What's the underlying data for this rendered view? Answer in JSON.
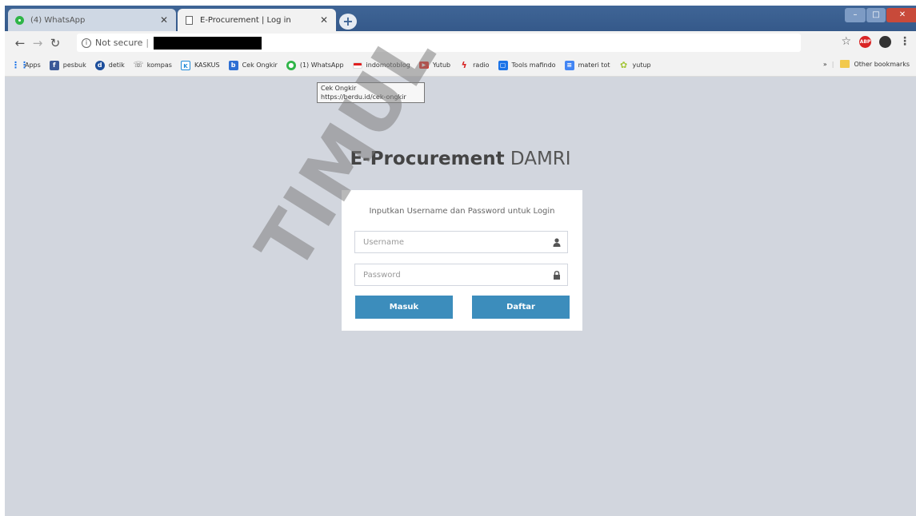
{
  "browser": {
    "tabs": [
      {
        "title": "(4) WhatsApp",
        "icon": "whatsapp-icon",
        "active": false
      },
      {
        "title": "E-Procurement | Log in",
        "icon": "page-icon",
        "active": true
      }
    ],
    "address": {
      "security_label": "Not secure"
    },
    "bookmarks": [
      {
        "label": "Apps",
        "icon": "apps-grid-icon",
        "color": "#1a73e8"
      },
      {
        "label": "pesbuk",
        "icon": "facebook-icon",
        "color": "#3b5998"
      },
      {
        "label": "detik",
        "icon": "detik-icon",
        "color": "#1d4f9c"
      },
      {
        "label": "kompas",
        "icon": "kompas-icon",
        "color": "#555555"
      },
      {
        "label": "KASKUS",
        "icon": "kaskus-icon",
        "color": "#1f8ad8"
      },
      {
        "label": "Cek Ongkir",
        "icon": "berdu-icon",
        "color": "#2e6fd3"
      },
      {
        "label": "(1) WhatsApp",
        "icon": "whatsapp-icon",
        "color": "#2fb548"
      },
      {
        "label": "indomotoblog",
        "icon": "flag-icon",
        "color": "#e02020"
      },
      {
        "label": "Yutub",
        "icon": "youtube-icon",
        "color": "#e62117"
      },
      {
        "label": "radio",
        "icon": "radio-icon",
        "color": "#d62020"
      },
      {
        "label": "Tools mafindo",
        "icon": "tools-icon",
        "color": "#1a73e8"
      },
      {
        "label": "materi tot",
        "icon": "doc-icon",
        "color": "#4285f4"
      },
      {
        "label": "yutup",
        "icon": "android-icon",
        "color": "#a4c639"
      }
    ],
    "bookmarks_overflow": "»",
    "other_bookmarks": "Other bookmarks",
    "tooltip": {
      "line1": "Cek Ongkir",
      "line2": "https://berdu.id/cek-ongkir"
    }
  },
  "login": {
    "brand_bold": "E-Procurement",
    "brand_light": "DAMRI",
    "message": "Inputkan Username dan Password untuk Login",
    "username_placeholder": "Username",
    "password_placeholder": "Password",
    "login_button": "Masuk",
    "register_button": "Daftar"
  },
  "watermark": "TIMUL",
  "colors": {
    "primary_button": "#3c8dbc",
    "page_background": "#d2d6de",
    "titlebar": "#3f6596"
  }
}
